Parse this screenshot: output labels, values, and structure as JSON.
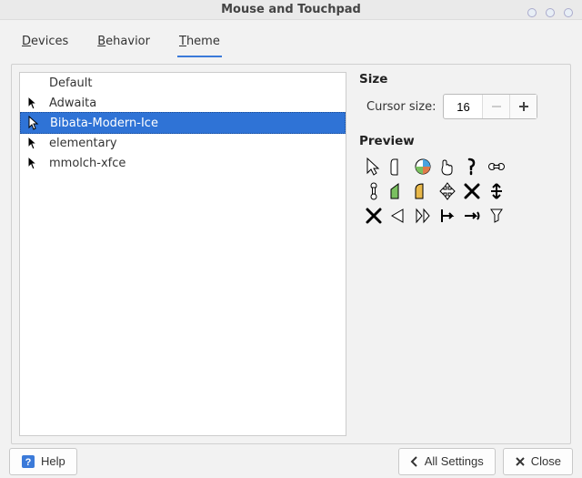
{
  "window": {
    "title": "Mouse and Touchpad"
  },
  "tabs": {
    "devices": "Devices",
    "behavior": "Behavior",
    "theme": "Theme",
    "active": "theme"
  },
  "themes": [
    {
      "name": "Default",
      "icon": "none",
      "selected": false
    },
    {
      "name": "Adwaita",
      "icon": "cursor-black",
      "selected": false
    },
    {
      "name": "Bibata-Modern-Ice",
      "icon": "cursor-white",
      "selected": true
    },
    {
      "name": "elementary",
      "icon": "cursor-black",
      "selected": false
    },
    {
      "name": "mmolch-xfce",
      "icon": "cursor-black",
      "selected": false
    }
  ],
  "size": {
    "heading": "Size",
    "label": "Cursor size:",
    "value": "16",
    "minus_disabled": true
  },
  "preview": {
    "heading": "Preview"
  },
  "footer": {
    "help": "Help",
    "all_settings": "All Settings",
    "close": "Close"
  }
}
